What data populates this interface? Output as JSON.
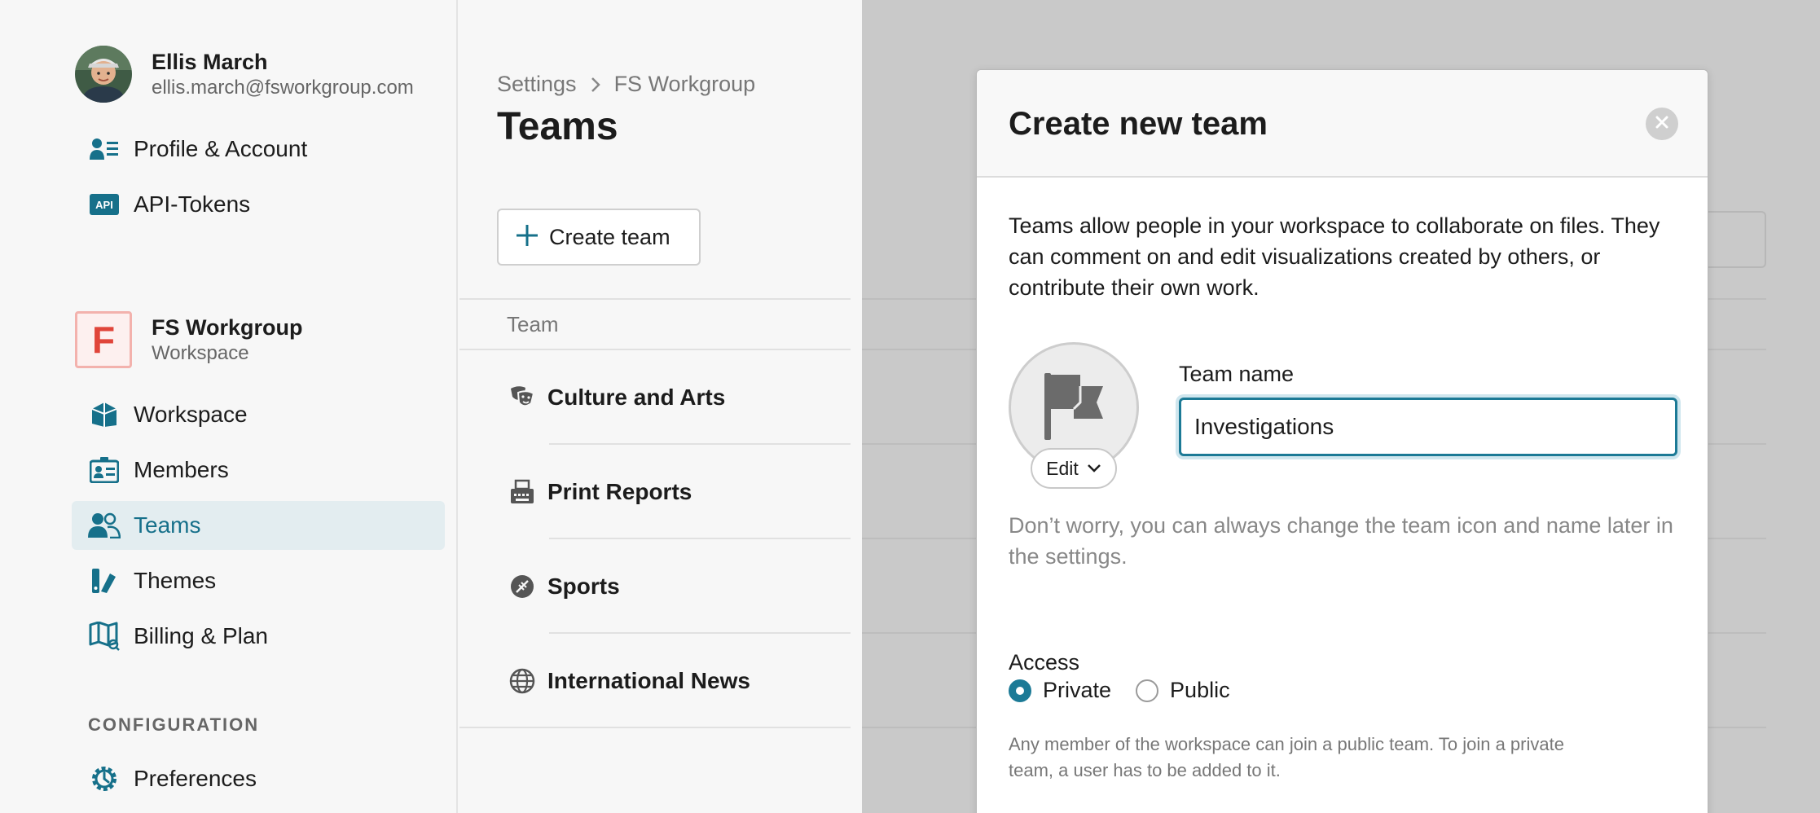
{
  "user": {
    "name": "Ellis March",
    "email": "ellis.march@fsworkgroup.com"
  },
  "account_nav": [
    {
      "label": "Profile & Account",
      "icon": "profile-card-icon"
    },
    {
      "label": "API-Tokens",
      "icon": "api-icon",
      "icon_text": "API"
    }
  ],
  "workspace": {
    "initial": "F",
    "name": "FS Workgroup",
    "subtitle": "Workspace"
  },
  "workspace_nav": [
    {
      "label": "Workspace",
      "icon": "workspace-house-icon"
    },
    {
      "label": "Members",
      "icon": "members-card-icon"
    },
    {
      "label": "Teams",
      "icon": "teams-people-icon",
      "active": true
    },
    {
      "label": "Themes",
      "icon": "themes-swatch-icon"
    },
    {
      "label": "Billing & Plan",
      "icon": "billing-map-icon"
    }
  ],
  "config": {
    "section_label": "CONFIGURATION",
    "items": [
      {
        "label": "Preferences",
        "icon": "gear-icon"
      }
    ]
  },
  "teams_page": {
    "breadcrumb": [
      "Settings",
      "FS Workgroup"
    ],
    "title": "Teams",
    "create_label": "Create team",
    "column_header": "Team",
    "teams": [
      {
        "name": "Culture and Arts",
        "icon": "theater-masks-icon"
      },
      {
        "name": "Print Reports",
        "icon": "typewriter-icon"
      },
      {
        "name": "Sports",
        "icon": "football-icon"
      },
      {
        "name": "International News",
        "icon": "globe-icon"
      }
    ]
  },
  "modal": {
    "title": "Create new team",
    "intro": "Teams allow people in your workspace to collaborate on files. They can comment on and edit visualizations created by others, or contribute their own work.",
    "edit_label": "Edit",
    "field_label": "Team name",
    "team_name_value": "Investigations",
    "hint": "Don’t worry, you can always change the team icon and name later in the settings.",
    "access_label": "Access",
    "access_options": [
      {
        "label": "Private",
        "selected": true
      },
      {
        "label": "Public",
        "selected": false
      }
    ],
    "access_note": "Any member of the workspace can join a public team. To join a private team, a user has to be added to it."
  },
  "colors": {
    "accent": "#1c7a96",
    "active_bg": "#e3edf0",
    "workspace_logo": "#e0453a",
    "backdrop": "#c9c9c9"
  }
}
